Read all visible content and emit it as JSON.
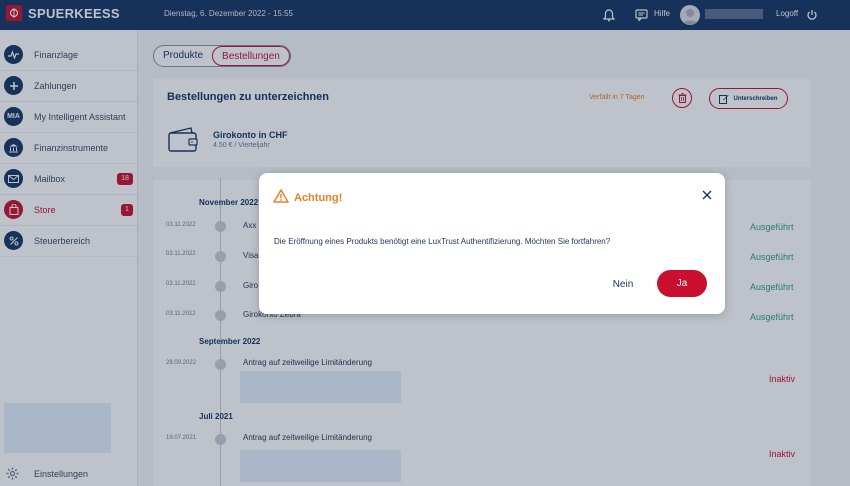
{
  "header": {
    "brand": "SPUERKEESS",
    "datetime": "Dienstag, 6. Dezember 2022 - 15:55",
    "help_label": "Hilfe",
    "logoff_label": "Logoff"
  },
  "sidebar": {
    "items": [
      {
        "label": "Finanzlage",
        "icon": "chart-icon"
      },
      {
        "label": "Zahlungen",
        "icon": "plus-icon"
      },
      {
        "label": "My Intelligent Assistant",
        "icon_text": "MIA"
      },
      {
        "label": "Finanzinstrumente",
        "icon": "bank-icon"
      },
      {
        "label": "Mailbox",
        "icon": "mail-icon",
        "badge": "18"
      },
      {
        "label": "Store",
        "icon": "bag-icon",
        "badge": "1"
      },
      {
        "label": "Steuerbereich",
        "icon": "percent-icon"
      }
    ],
    "settings_label": "Einstellungen"
  },
  "tabs": {
    "products": "Produkte",
    "orders": "Bestellungen"
  },
  "pending": {
    "title": "Bestellungen zu unterzeichnen",
    "expiry": "Verfällt in 7 Tagen",
    "sign_label": "Unterschreiben",
    "product_name": "Girokonto in CHF",
    "product_price": "4.50 € / Vierteljahr"
  },
  "timeline": {
    "months": [
      "November 2022",
      "September 2022",
      "Juli 2021"
    ],
    "entries": [
      {
        "date": "03.11.2022",
        "text": "Axx",
        "status": "Ausgeführt"
      },
      {
        "date": "03.11.2022",
        "text": "Visa",
        "status": "Ausgeführt"
      },
      {
        "date": "03.11.2022",
        "text": "Giro",
        "status": "Ausgeführt"
      },
      {
        "date": "03.11.2022",
        "text": "Girokonto Zebra",
        "status": "Ausgeführt"
      },
      {
        "date": "28.09.2022",
        "text": "Antrag auf zeitweilige Limitänderung",
        "status": "Inaktiv"
      },
      {
        "date": "19.07.2021",
        "text": "Antrag auf zeitweilige Limitänderung",
        "status": "Inaktiv"
      }
    ]
  },
  "modal": {
    "title": "Achtung!",
    "message": "Die Eröffnung eines Produkts benötigt eine LuxTrust Authentifizierung. Möchten Sie fortfahren?",
    "no_label": "Nein",
    "yes_label": "Ja"
  },
  "colors": {
    "brand_navy": "#173563",
    "accent_red": "#c8102e",
    "warning_orange": "#e3822c",
    "success_green": "#2f9c80"
  }
}
